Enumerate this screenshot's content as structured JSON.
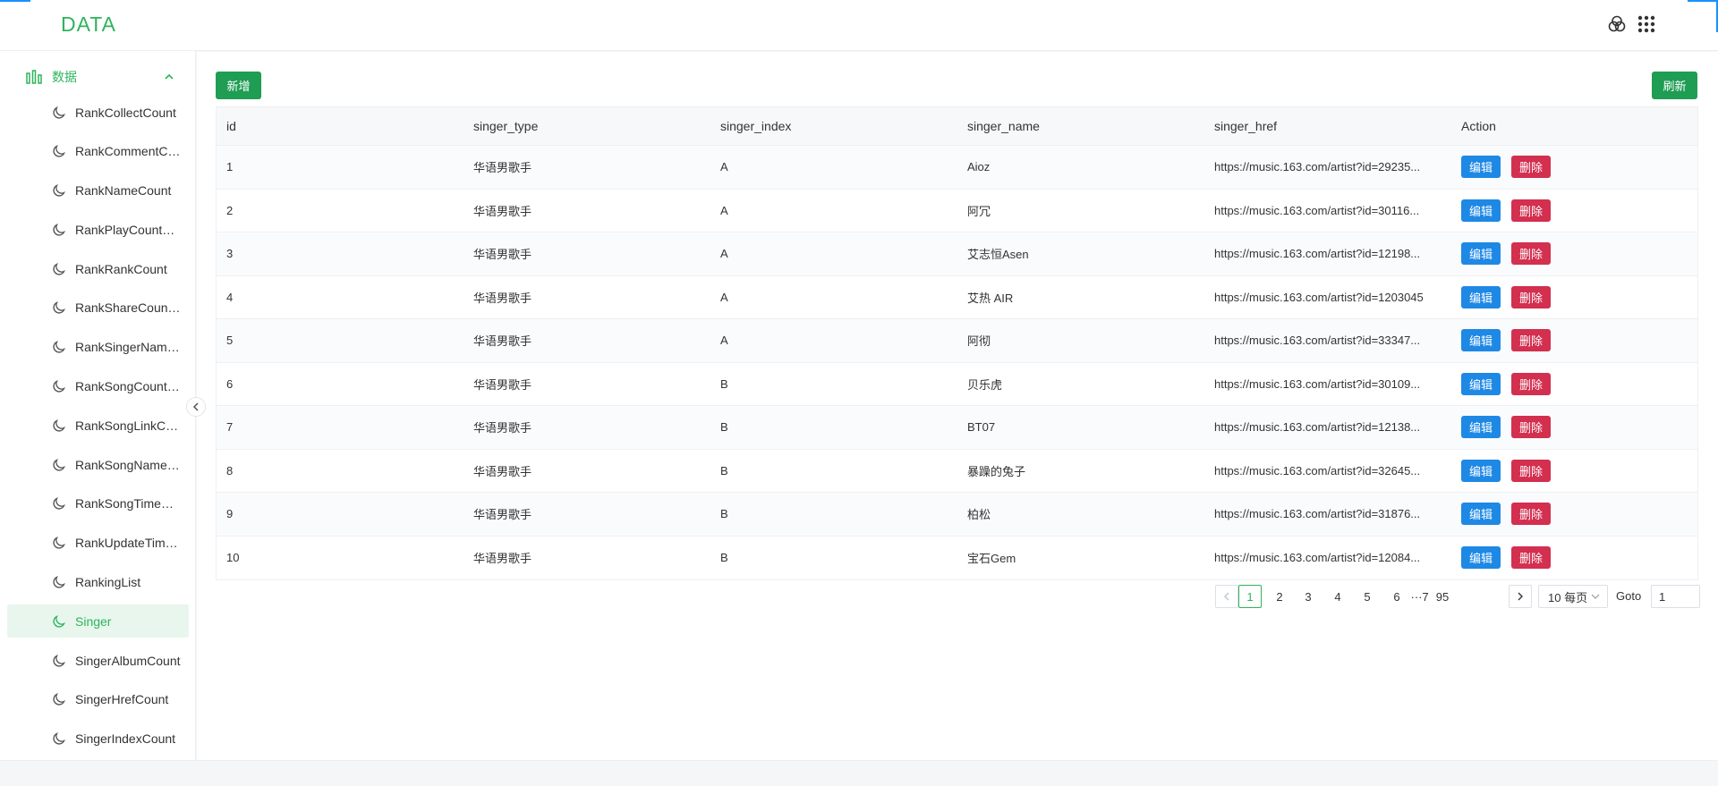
{
  "header": {
    "brand": "DATA",
    "icons": [
      "circles-icon",
      "apps-grid-icon"
    ]
  },
  "sidebar": {
    "group": {
      "label": "数据",
      "icon": "bar-chart-icon",
      "caret": "chevron-up-icon"
    },
    "items": [
      {
        "label": "RankCollectCount",
        "icon": "moon-icon"
      },
      {
        "label": "RankCommentCount",
        "icon": "moon-icon"
      },
      {
        "label": "RankNameCount",
        "icon": "moon-icon"
      },
      {
        "label": "RankPlayCountCount",
        "icon": "moon-icon"
      },
      {
        "label": "RankRankCount",
        "icon": "moon-icon"
      },
      {
        "label": "RankShareCountCount",
        "icon": "moon-icon"
      },
      {
        "label": "RankSingerNameCount",
        "icon": "moon-icon"
      },
      {
        "label": "RankSongCountCount",
        "icon": "moon-icon"
      },
      {
        "label": "RankSongLinkCount",
        "icon": "moon-icon"
      },
      {
        "label": "RankSongNameCount",
        "icon": "moon-icon"
      },
      {
        "label": "RankSongTimeCount",
        "icon": "moon-icon"
      },
      {
        "label": "RankUpdateTimeCount",
        "icon": "moon-icon"
      },
      {
        "label": "RankingList",
        "icon": "moon-icon"
      },
      {
        "label": "Singer",
        "icon": "moon-icon",
        "active": true
      },
      {
        "label": "SingerAlbumCount",
        "icon": "moon-icon"
      },
      {
        "label": "SingerHrefCount",
        "icon": "moon-icon"
      },
      {
        "label": "SingerIndexCount",
        "icon": "moon-icon"
      }
    ]
  },
  "toolbar": {
    "add_label": "新增",
    "refresh_label": "刷新"
  },
  "table": {
    "columns": [
      "id",
      "singer_type",
      "singer_index",
      "singer_name",
      "singer_href",
      "Action"
    ],
    "rows": [
      {
        "id": "1",
        "singer_type": "华语男歌手",
        "singer_index": "A",
        "singer_name": "Aioz",
        "singer_href": "https://music.163.com/artist?id=29235..."
      },
      {
        "id": "2",
        "singer_type": "华语男歌手",
        "singer_index": "A",
        "singer_name": "阿冗",
        "singer_href": "https://music.163.com/artist?id=30116..."
      },
      {
        "id": "3",
        "singer_type": "华语男歌手",
        "singer_index": "A",
        "singer_name": "艾志恒Asen",
        "singer_href": "https://music.163.com/artist?id=12198..."
      },
      {
        "id": "4",
        "singer_type": "华语男歌手",
        "singer_index": "A",
        "singer_name": "艾热 AIR",
        "singer_href": "https://music.163.com/artist?id=1203045"
      },
      {
        "id": "5",
        "singer_type": "华语男歌手",
        "singer_index": "A",
        "singer_name": "阿彻",
        "singer_href": "https://music.163.com/artist?id=33347..."
      },
      {
        "id": "6",
        "singer_type": "华语男歌手",
        "singer_index": "B",
        "singer_name": "贝乐虎",
        "singer_href": "https://music.163.com/artist?id=30109..."
      },
      {
        "id": "7",
        "singer_type": "华语男歌手",
        "singer_index": "B",
        "singer_name": "BT07",
        "singer_href": "https://music.163.com/artist?id=12138..."
      },
      {
        "id": "8",
        "singer_type": "华语男歌手",
        "singer_index": "B",
        "singer_name": "暴躁的兔子",
        "singer_href": "https://music.163.com/artist?id=32645..."
      },
      {
        "id": "9",
        "singer_type": "华语男歌手",
        "singer_index": "B",
        "singer_name": "柏松",
        "singer_href": "https://music.163.com/artist?id=31876..."
      },
      {
        "id": "10",
        "singer_type": "华语男歌手",
        "singer_index": "B",
        "singer_name": "宝石Gem",
        "singer_href": "https://music.163.com/artist?id=12084..."
      }
    ],
    "edit_label": "编辑",
    "delete_label": "删除"
  },
  "pagination": {
    "pages": [
      "1",
      "2",
      "3",
      "4",
      "5",
      "6",
      "7"
    ],
    "ellipsis": "···",
    "last_page": "95",
    "current": "1",
    "page_size": "10 每页",
    "goto_label": "Goto",
    "goto_value": "1"
  },
  "colors": {
    "brand": "#2eb45b",
    "primary_green": "#1f9d53",
    "edit_blue": "#1e88e5",
    "delete_red": "#d32f4f",
    "active_bg": "#e8f6ee"
  }
}
